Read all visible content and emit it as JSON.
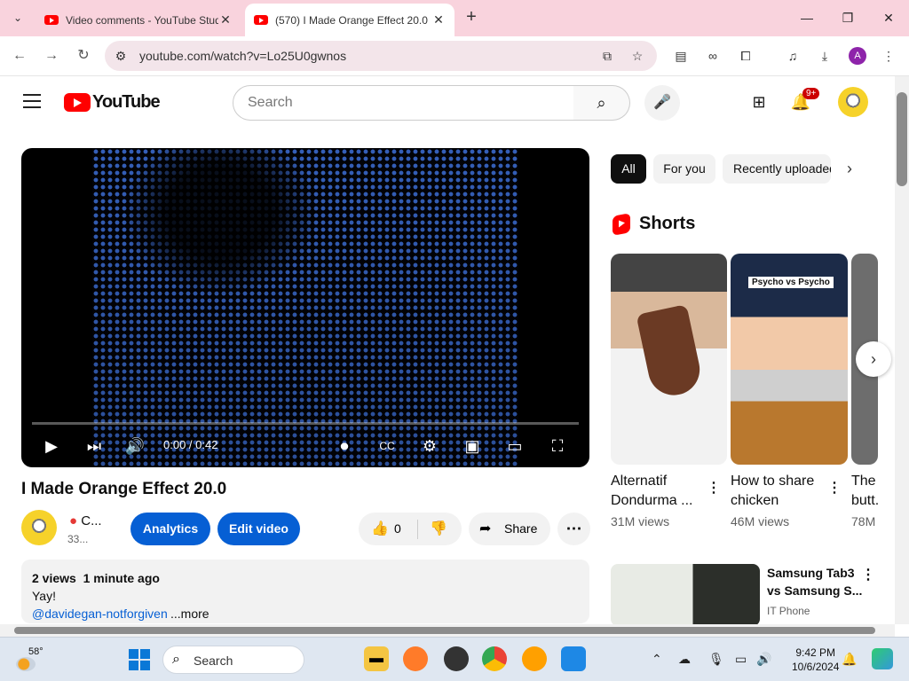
{
  "browser": {
    "tabs": [
      {
        "title": "Video comments - YouTube Studio",
        "active": false
      },
      {
        "title": "(570) I Made Orange Effect 20.0",
        "active": true
      }
    ],
    "url": "youtube.com/watch?v=Lo25U0gwnos",
    "profile_initial": "A"
  },
  "yt_header": {
    "logo_text": "YouTube",
    "search_placeholder": "Search",
    "notif_badge": "9+"
  },
  "player": {
    "time": "0:00 / 0:42",
    "progress": 0.0
  },
  "video": {
    "title": "I Made Orange Effect 20.0",
    "channel_name": "C...",
    "channel_subs": "33...",
    "analytics_label": "Analytics",
    "edit_label": "Edit video",
    "likes": "0",
    "share_label": "Share",
    "meta": "2 views  1 minute ago",
    "description": "Yay!",
    "mention": "@davidegan-notforgiven",
    "more_label": "...more"
  },
  "chips": [
    "All",
    "For you",
    "Recently uploaded"
  ],
  "shorts": {
    "heading": "Shorts",
    "items": [
      {
        "title": "Alternatif Dondurma ...",
        "views": "31M views",
        "overlay": ""
      },
      {
        "title": "How to share chicken",
        "views": "46M views",
        "overlay": "Psycho vs Psycho"
      },
      {
        "title": "The butt...",
        "views": "78M",
        "overlay": ""
      }
    ]
  },
  "recommended": [
    {
      "title": "Samsung Tab3 vs Samsung S...",
      "channel": "IT Phone"
    }
  ],
  "taskbar": {
    "weather_temp": "58°",
    "search_label": "Search",
    "time": "9:42 PM",
    "date": "10/6/2024"
  }
}
